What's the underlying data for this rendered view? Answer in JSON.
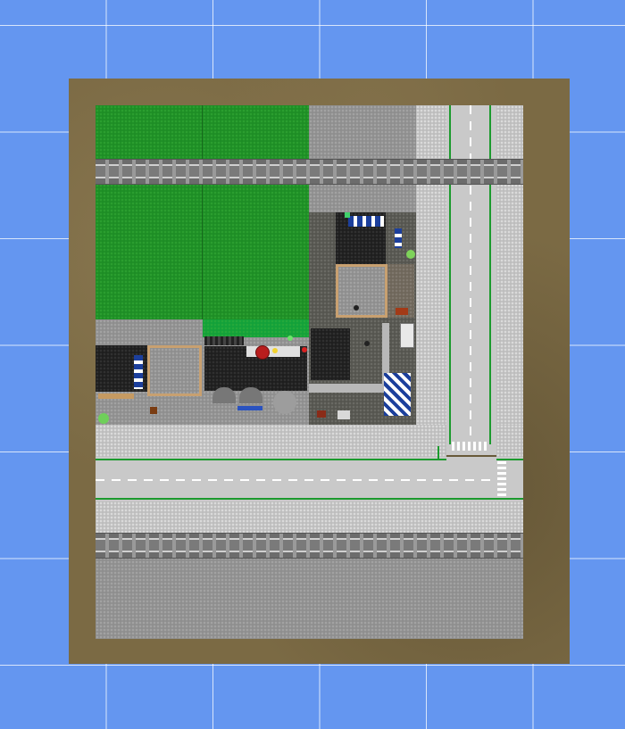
{
  "scene": {
    "kind": "lego-city-layout-top-view",
    "colors": {
      "background": "#6496f0",
      "grid_lines": "#ffffff",
      "board": "#7b6a44",
      "grass": "#1d8d25",
      "pavement": "#8e8e8e",
      "sidewalk": "#bdbdbd",
      "road": "#c9c9c9",
      "road_edge_line": "#1c9a2e",
      "rail": "#7a7a7a",
      "building_roof": "#1e1e1e",
      "awning_blue": "#1c3f9c",
      "accent_red": "#b81d1d"
    },
    "icons": [
      "track-icon",
      "tree-icon",
      "car-icon",
      "bench-icon",
      "lamp-icon"
    ]
  }
}
